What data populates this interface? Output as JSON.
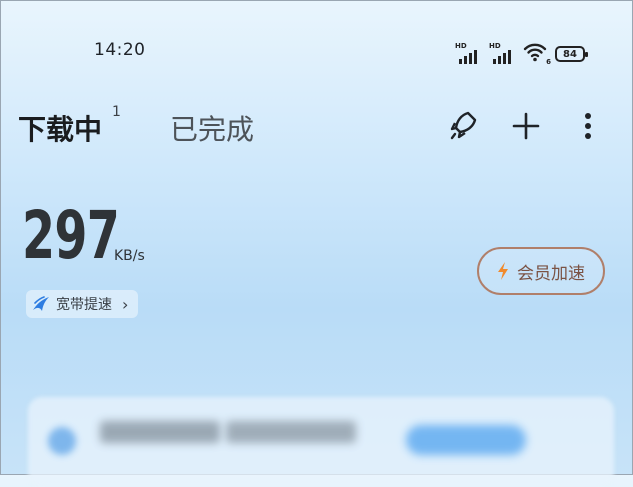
{
  "status_bar": {
    "time": "14:20",
    "signal_1_label": "HD",
    "signal_2_label": "HD",
    "wifi_badge": "6",
    "battery_level": "84",
    "icons": [
      "signal-hd-icon",
      "signal-hd-icon",
      "wifi-icon",
      "battery-icon"
    ]
  },
  "header": {
    "tabs": [
      {
        "label": "下载中",
        "count": "1",
        "active": true
      },
      {
        "label": "已完成",
        "active": false
      }
    ],
    "actions": [
      "rocket-icon",
      "plus-icon",
      "more-vertical-icon"
    ]
  },
  "speed": {
    "value": "297",
    "unit": "KB/s"
  },
  "broadband": {
    "label": "宽带提速",
    "icon": "swift-bird-icon"
  },
  "vip": {
    "label": "会员加速",
    "icon": "lightning-icon"
  },
  "colors": {
    "accent_orange": "#f08a2c",
    "vip_border": "#b07f6a",
    "broadband_icon": "#2f7de1"
  }
}
